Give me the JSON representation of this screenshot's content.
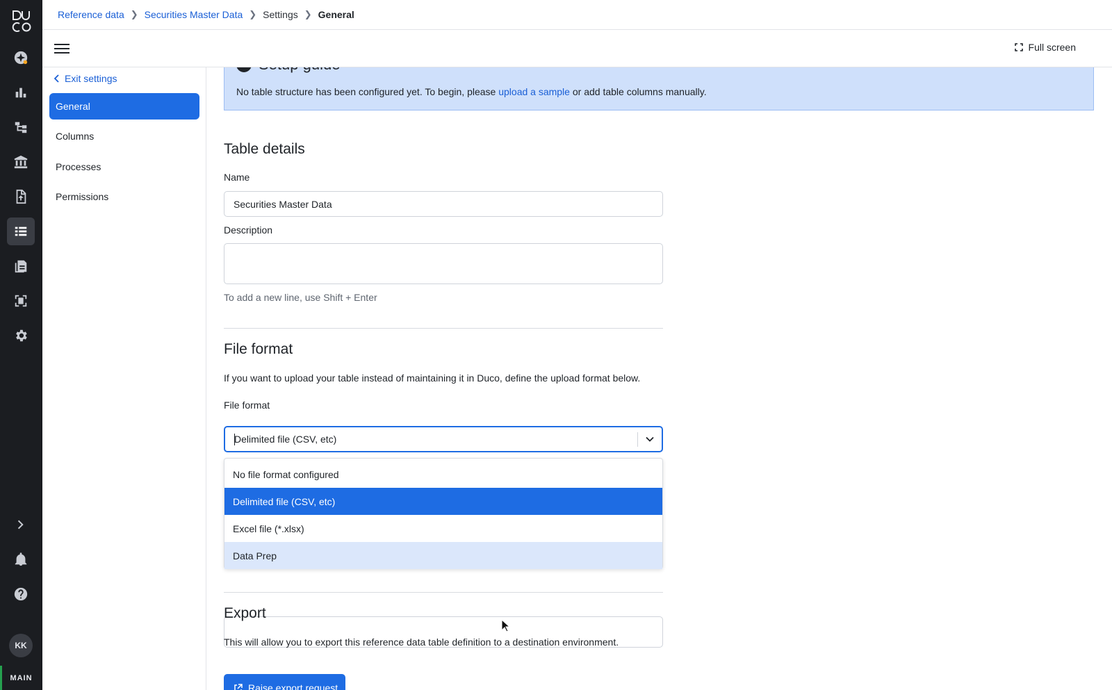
{
  "app": {
    "logo_text": "DUCO",
    "environment": "MAIN",
    "user_initials": "KK"
  },
  "breadcrumb": {
    "items": [
      "Reference data",
      "Securities Master Data",
      "Settings"
    ],
    "current": "General"
  },
  "toolbar": {
    "fullscreen_label": "Full screen"
  },
  "sidenav": {
    "exit_label": "Exit settings",
    "items": [
      {
        "label": "General",
        "active": true
      },
      {
        "label": "Columns",
        "active": false
      },
      {
        "label": "Processes",
        "active": false
      },
      {
        "label": "Permissions",
        "active": false
      }
    ]
  },
  "setup_guide": {
    "title": "Setup guide",
    "text_before": "No table structure has been configured yet. To begin, please ",
    "link_label": "upload a sample",
    "text_after": " or add table columns manually."
  },
  "table_details": {
    "heading": "Table details",
    "name_label": "Name",
    "name_value": "Securities Master Data",
    "description_label": "Description",
    "description_value": "",
    "description_hint": "To add a new line, use Shift + Enter"
  },
  "file_format": {
    "heading": "File format",
    "intro": "If you want to upload your table instead of maintaining it in Duco, define the upload format below.",
    "field_label": "File format",
    "selected_value": "Delimited file (CSV, etc)",
    "options": [
      "No file format configured",
      "Delimited file (CSV, etc)",
      "Excel file (*.xlsx)",
      "Data Prep"
    ],
    "selected_index": 1,
    "hover_index": 3
  },
  "export": {
    "heading": "Export",
    "text": "This will allow you to export this reference data table definition to a destination environment.",
    "button_label": "Raise export request"
  },
  "colors": {
    "accent": "#1e6ce3",
    "link": "#1a5fd6",
    "rail_bg": "#1b1d21",
    "guide_bg": "#cfe0fb",
    "hover_bg": "#dbe7fb",
    "env_marker": "#25a04f"
  },
  "icons": {
    "rail": [
      "ai-assistant-icon",
      "dashboard-chart-icon",
      "workflow-icon",
      "bank-icon",
      "file-upload-icon",
      "reference-data-icon",
      "reports-icon",
      "scanner-icon",
      "settings-gear-icon",
      "expand-chevron-icon",
      "notification-bell-icon",
      "help-icon"
    ]
  }
}
